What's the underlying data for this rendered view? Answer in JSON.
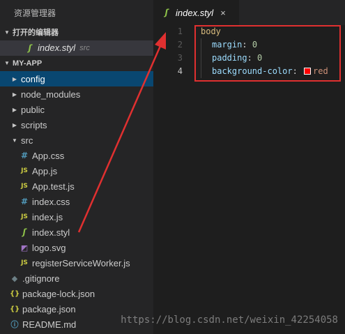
{
  "sidebar": {
    "title": "资源管理器",
    "open_editors": {
      "header": "打开的编辑器",
      "items": [
        {
          "name": "index.styl",
          "dir": "src",
          "icon": "stylus-icon"
        }
      ]
    },
    "project": {
      "header": "MY-APP",
      "tree": [
        {
          "label": "config",
          "type": "folder",
          "expanded": false,
          "selected": true
        },
        {
          "label": "node_modules",
          "type": "folder",
          "expanded": false
        },
        {
          "label": "public",
          "type": "folder",
          "expanded": false
        },
        {
          "label": "scripts",
          "type": "folder",
          "expanded": false
        },
        {
          "label": "src",
          "type": "folder",
          "expanded": true
        },
        {
          "label": "App.css",
          "type": "file",
          "icon": "css-icon"
        },
        {
          "label": "App.js",
          "type": "file",
          "icon": "js-icon"
        },
        {
          "label": "App.test.js",
          "type": "file",
          "icon": "js-icon"
        },
        {
          "label": "index.css",
          "type": "file",
          "icon": "css-icon"
        },
        {
          "label": "index.js",
          "type": "file",
          "icon": "js-icon"
        },
        {
          "label": "index.styl",
          "type": "file",
          "icon": "stylus-icon"
        },
        {
          "label": "logo.svg",
          "type": "file",
          "icon": "svg-icon"
        },
        {
          "label": "registerServiceWorker.js",
          "type": "file",
          "icon": "js-icon"
        },
        {
          "label": ".gitignore",
          "type": "file",
          "icon": "git-icon"
        },
        {
          "label": "package-lock.json",
          "type": "file",
          "icon": "json-icon"
        },
        {
          "label": "package.json",
          "type": "file",
          "icon": "json-icon"
        },
        {
          "label": "README.md",
          "type": "file",
          "icon": "info-icon"
        }
      ]
    }
  },
  "editor": {
    "tab": {
      "label": "index.styl",
      "close": "×"
    },
    "lines": [
      {
        "number": "1",
        "selector": "body"
      },
      {
        "number": "2",
        "property": "margin",
        "value": "0"
      },
      {
        "number": "3",
        "property": "padding",
        "value": "0"
      },
      {
        "number": "4",
        "property": "background-color",
        "value": "red",
        "swatch": "#ff0000"
      }
    ],
    "active_line": "4"
  },
  "watermark": "https://blog.csdn.net/weixin_42254058",
  "colors": {
    "accent_selection": "#094771",
    "annotation_red": "#e03030",
    "stylus_green": "#8dc149",
    "js_yellow": "#cbcb41",
    "css_blue": "#519aba"
  }
}
